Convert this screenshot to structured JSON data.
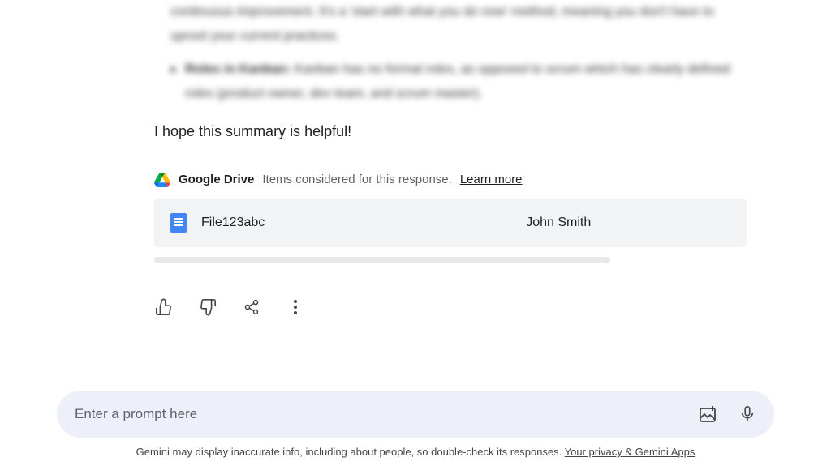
{
  "response": {
    "blurred": {
      "para1": "continuous improvement. It's a 'start with what you do now' method, meaning you don't have to uproot your current practices.",
      "bullet_title": "Roles in Kanban:",
      "bullet_body": "Kanban has no formal roles, as opposed to scrum which has clearly defined roles (product owner, dev team, and scrum master)."
    },
    "closing": "I hope this summary is helpful!"
  },
  "drive": {
    "label": "Google Drive",
    "subtext": "Items considered for this response.",
    "learn_more": "Learn more",
    "files": [
      {
        "name": "File123abc",
        "owner": "John Smith"
      }
    ]
  },
  "prompt": {
    "placeholder": "Enter a prompt here"
  },
  "disclaimer": {
    "text": "Gemini may display inaccurate info, including about people, so double-check its responses. ",
    "link": "Your privacy & Gemini Apps"
  }
}
